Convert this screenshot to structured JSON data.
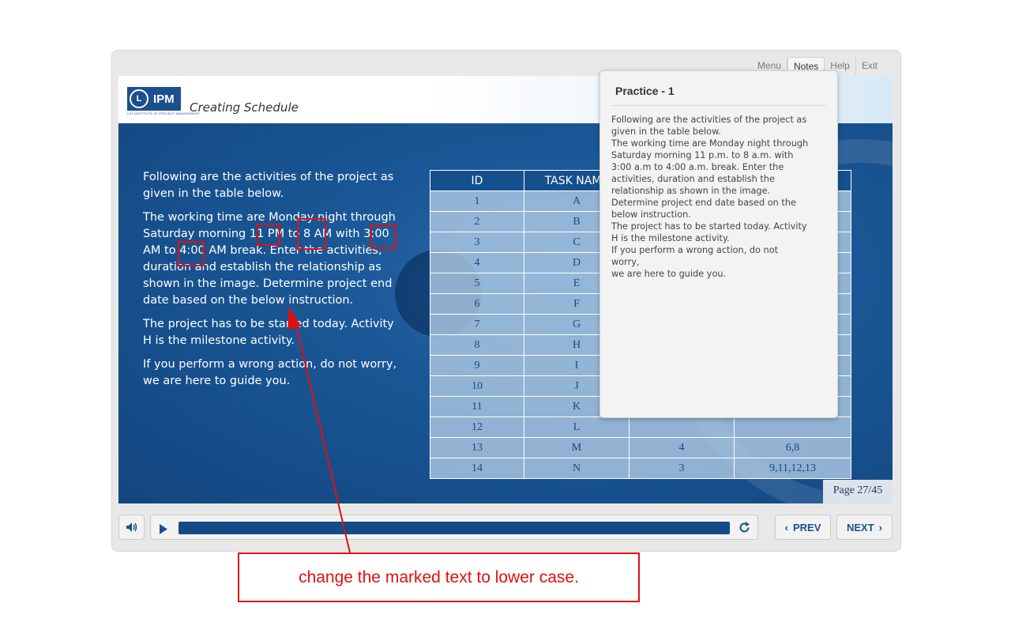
{
  "nav": {
    "menu": "Menu",
    "notes": "Notes",
    "help": "Help",
    "exit": "Exit"
  },
  "header": {
    "logo_text": "IPM",
    "logo_subtext": "L&T INSTITUTE OF PROJECT MANAGEMENT",
    "course_title": "Creating Schedule"
  },
  "content": {
    "paragraphs": [
      "Following are the activities of the project as given in the table below.",
      "The working time are Monday night through Saturday morning 11 PM to 8 AM with 3:00 AM to 4:00 AM break. Enter the activities, duration and establish the relationship as shown in the image. Determine project end date based on the below instruction.",
      "The project has to be started today. Activity H is the milestone activity.",
      "If you perform a wrong action, do not worry, we are here to guide you."
    ]
  },
  "table": {
    "headers": [
      "ID",
      "TASK NAME",
      "",
      ""
    ],
    "rows": [
      [
        "1",
        "A",
        "",
        ""
      ],
      [
        "2",
        "B",
        "",
        ""
      ],
      [
        "3",
        "C",
        "",
        ""
      ],
      [
        "4",
        "D",
        "",
        ""
      ],
      [
        "5",
        "E",
        "",
        ""
      ],
      [
        "6",
        "F",
        "",
        ""
      ],
      [
        "7",
        "G",
        "",
        ""
      ],
      [
        "8",
        "H",
        "",
        ""
      ],
      [
        "9",
        "I",
        "",
        ""
      ],
      [
        "10",
        "J",
        "",
        ""
      ],
      [
        "11",
        "K",
        "",
        ""
      ],
      [
        "12",
        "L",
        "",
        ""
      ],
      [
        "13",
        "M",
        "4",
        "6,8"
      ],
      [
        "14",
        "N",
        "3",
        "9,11,12,13"
      ]
    ]
  },
  "notes_panel": {
    "title": "Practice - 1",
    "lines": [
      "Following are the activities of the project as",
      "given in the table below.",
      "The working time are Monday night through",
      "Saturday morning 11 p.m. to 8 a.m. with",
      "3:00 a.m to 4:00 a.m. break. Enter the",
      "activities, duration and establish the",
      "relationship as shown in the image.",
      "Determine project end date based on the",
      "below instruction.",
      "The project has to be started today. Activity",
      "H is the milestone activity.",
      "If you perform a wrong action, do not worry,",
      "we are here to guide you."
    ]
  },
  "footer": {
    "page_label": "Page 27/45",
    "prev_label": "PREV",
    "next_label": "NEXT",
    "progress_fraction": 1.0
  },
  "annotation": {
    "instruction": "change the marked text to lower case."
  },
  "colors": {
    "stage_blue": "#1a5796",
    "annotation_red": "#e01010",
    "brand_blue": "#1c4f8e"
  }
}
